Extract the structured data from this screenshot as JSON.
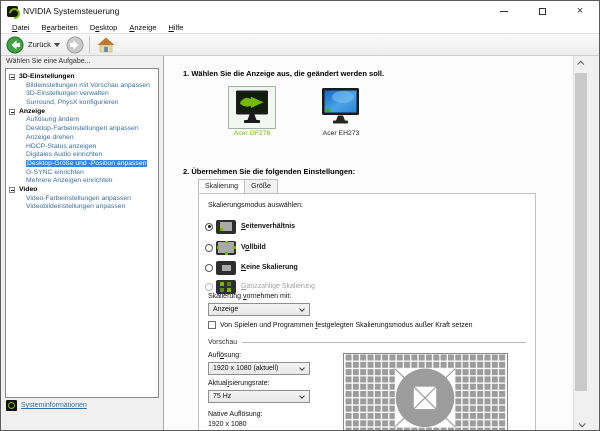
{
  "window": {
    "title": "NVIDIA Systemsteuerung"
  },
  "menu": {
    "items": [
      {
        "label": "Datei",
        "mnemonic": 0
      },
      {
        "label": "Bearbeiten",
        "mnemonic": 1
      },
      {
        "label": "Desktop",
        "mnemonic": 1
      },
      {
        "label": "Anzeige",
        "mnemonic": 0
      },
      {
        "label": "Hilfe",
        "mnemonic": 0
      }
    ]
  },
  "toolbar": {
    "back_label": "Zurück"
  },
  "sidebar": {
    "header": "Wählen Sie eine Aufgabe...",
    "tree": [
      {
        "label": "3D-Einstellungen",
        "type": "category"
      },
      {
        "label": "Bildeinstellungen mit Vorschau anpassen",
        "type": "link"
      },
      {
        "label": "3D-Einstellungen verwalten",
        "type": "link"
      },
      {
        "label": "Surround, PhysX konfigurieren",
        "type": "link"
      },
      {
        "label": "Anzeige",
        "type": "category"
      },
      {
        "label": "Auflösung ändern",
        "type": "link"
      },
      {
        "label": "Desktop-Farbeinstellungen anpassen",
        "type": "link"
      },
      {
        "label": "Anzeige drehen",
        "type": "link"
      },
      {
        "label": "HDCP-Status anzeigen",
        "type": "link"
      },
      {
        "label": "Digitales Audio einrichten",
        "type": "link"
      },
      {
        "label": "Desktop-Größe und -Position anpassen",
        "type": "link",
        "selected": true
      },
      {
        "label": "G-SYNC einrichten",
        "type": "link"
      },
      {
        "label": "Mehrere Anzeigen einrichten",
        "type": "link"
      },
      {
        "label": "Video",
        "type": "category"
      },
      {
        "label": "Video-Farbeinstellungen anpassen",
        "type": "link"
      },
      {
        "label": "Videobildeinstellungen anpassen",
        "type": "link"
      }
    ],
    "system_info": "Systeminformationen"
  },
  "main": {
    "step1_heading": "1. Wählen Sie die Anzeige aus, die geändert werden soll.",
    "displays": [
      {
        "name": "Acer GF276",
        "selected": true
      },
      {
        "name": "Acer EH273",
        "selected": false
      }
    ],
    "step2_heading": "2. Übernehmen Sie die folgenden Einstellungen:",
    "tabs": [
      {
        "label": "Skalierung",
        "active": true
      },
      {
        "label": "Größe",
        "active": false
      }
    ],
    "scaling": {
      "mode_label": "Skalierungsmodus auswählen:",
      "modes": [
        {
          "label": "Seitenverhältnis",
          "selected": true,
          "mnemonic": 0
        },
        {
          "label": "Vollbild",
          "selected": false,
          "mnemonic": 1
        },
        {
          "label": "Keine Skalierung",
          "selected": false,
          "mnemonic": 0
        },
        {
          "label": "Ganzzahlige Skalierung",
          "selected": false,
          "disabled": true,
          "mnemonic": 0
        }
      ],
      "perform_label": "Skalierung vornehmen mit:",
      "perform_mnemonic": 11,
      "perform_value": "Anzeige",
      "override_checkbox": "Von Spielen und Programmen festgelegten Skalierungsmodus außer Kraft setzen",
      "override_mnemonic": 27,
      "override_checked": false
    },
    "preview": {
      "section_label": "Vorschau",
      "resolution_label": "Auflösung:",
      "resolution_mnemonic": 4,
      "resolution_value": "1920 x 1080 (aktuell)",
      "refresh_label": "Aktualisierungsrate:",
      "refresh_mnemonic": 6,
      "refresh_value": "75 Hz",
      "native_label": "Native Auflösung:",
      "native_value": "1920 x 1080"
    }
  },
  "theme": {
    "nvidia_green": "#76b900",
    "link_blue": "#3c6e9f",
    "selection_blue": "#2e86e8",
    "checker_gray": "#9c9c9c"
  }
}
